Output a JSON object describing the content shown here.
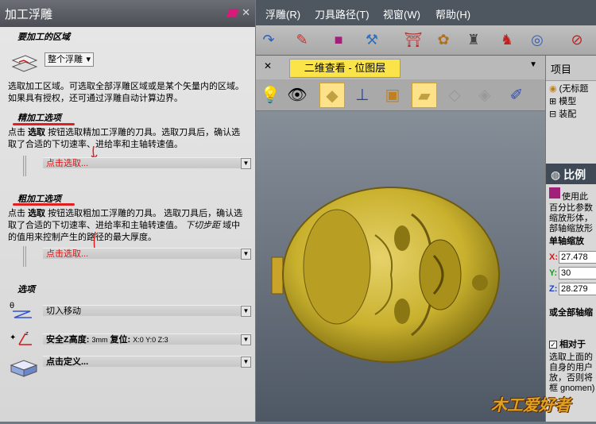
{
  "left_panel": {
    "title": "加工浮雕",
    "section_region": {
      "title": "要加工的区域",
      "select_value": "整个浮雕",
      "desc": "选取加工区域。可选取全部浮雕区域或是某个矢量内的区域。如果具有授权，还可通过浮雕自动计算边界。"
    },
    "section_finish": {
      "title": "精加工选项",
      "desc_prefix": "点击",
      "desc_bold": "选取",
      "desc_rest": "按钮选取精加工浮雕的刀具。选取刀具后，确认选取了合适的下切速率、进给率和主轴转速值。",
      "tool_label": "点击选取..."
    },
    "section_rough": {
      "title": "粗加工选项",
      "desc_prefix": "点击",
      "desc_bold": "选取",
      "desc_rest": "按钮选取粗加工浮雕的刀具。 选取刀具后，确认选取了合适的下切速率、进给率和主轴转速值。",
      "desc_italic": "下切步距",
      "desc_tail": "域中的值用来控制产生的路径的最大厚度。",
      "tool_label": "点击选取..."
    },
    "section_options": {
      "title": "选项",
      "lead_in_label": "切入移动",
      "safe_z_label": "安全Z高度:",
      "safe_z_value": "3mm",
      "home_label": "复位:",
      "home_value": "X:0 Y:0 Z:3",
      "define_label": "点击定义..."
    }
  },
  "menu": {
    "items": [
      "浮雕(R)",
      "刀具路径(T)",
      "视窗(W)",
      "帮助(H)"
    ]
  },
  "tabs": {
    "active_label": "二维查看 - 位图层"
  },
  "right_panel": {
    "project_title": "项目",
    "tree": [
      "(无标题",
      "模型",
      "装配"
    ],
    "scale_title": "比例",
    "scale_desc": [
      "使用此",
      "百分比参数",
      "缩放形体，",
      "部轴缩放形"
    ],
    "single_axis_label": "单轴缩放",
    "x_value": "27.478",
    "y_value": "30",
    "z_value": "28.279",
    "all_axis_label": "或全部轴缩",
    "relative_label": "相对于",
    "relative_desc": [
      "选取上面的",
      "自身的用户",
      "放，否则将",
      "框 gnomen)"
    ]
  },
  "watermark": "木工爱好者",
  "colors": {
    "accent_red": "#d21818",
    "tab_yellow": "#fbe44a",
    "model_gold": "#c9b12e"
  }
}
